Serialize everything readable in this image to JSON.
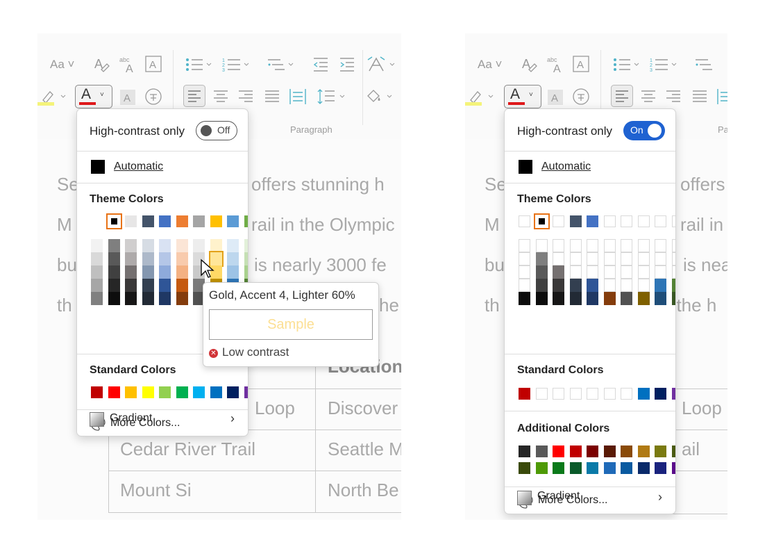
{
  "left": {
    "ribbon": {
      "font_aa": "Aa",
      "group_label": "Paragraph"
    },
    "doc_lines": [
      "Se",
      "M",
      "bu",
      "th"
    ],
    "doc_lines_right": [
      "offers stunning h",
      "rail in the Olympic",
      "is nearly 3000  fe",
      "he"
    ],
    "table": {
      "header_location": "Location",
      "rows": [
        {
          "name": "Loop",
          "location": "Discover"
        },
        {
          "name": "Cedar River Trail",
          "location": "Seattle M"
        },
        {
          "name": "Mount Si",
          "location": "North Be"
        }
      ]
    },
    "menu": {
      "high_contrast_label": "High-contrast only",
      "toggle_state": "Off",
      "automatic": "Automatic",
      "theme_colors": "Theme Colors",
      "theme_top": [
        "#ffffff",
        "#000000",
        "#e7e6e6",
        "#44546a",
        "#4472c4",
        "#ed7d31",
        "#a5a5a5",
        "#ffc000",
        "#5b9bd5",
        "#70ad47"
      ],
      "theme_shades": [
        [
          "#f2f2f2",
          "#d9d9d9",
          "#bfbfbf",
          "#a6a6a6",
          "#808080"
        ],
        [
          "#7f7f7f",
          "#595959",
          "#404040",
          "#262626",
          "#0d0d0d"
        ],
        [
          "#d0cece",
          "#aeaaaa",
          "#757070",
          "#3a3838",
          "#171616"
        ],
        [
          "#d6dce4",
          "#adb9ca",
          "#8497b0",
          "#333f50",
          "#222a35"
        ],
        [
          "#d9e2f3",
          "#b4c6e7",
          "#8eaadb",
          "#2f5597",
          "#1f3864"
        ],
        [
          "#fbe5d6",
          "#f8cbad",
          "#f4b183",
          "#c55a11",
          "#843c0c"
        ],
        [
          "#ededed",
          "#dbdbdb",
          "#c9c9c9",
          "#7b7b7b",
          "#525252"
        ],
        [
          "#fff2cc",
          "#ffe699",
          "#ffd966",
          "#bf9000",
          "#7f6000"
        ],
        [
          "#deebf7",
          "#bdd7ee",
          "#9dc3e6",
          "#2e75b6",
          "#1f4e79"
        ],
        [
          "#e2f0d9",
          "#c5e0b4",
          "#a9d18e",
          "#548235",
          "#385723"
        ]
      ],
      "standard_colors": "Standard Colors",
      "standard": [
        "#c00000",
        "#ff0000",
        "#ffc000",
        "#ffff00",
        "#92d050",
        "#00b050",
        "#00b0f0",
        "#0070c0",
        "#002060",
        "#7030a0"
      ],
      "more_colors": "More Colors...",
      "gradient": "Gradient"
    },
    "tooltip": {
      "title": "Gold, Accent 4, Lighter 60%",
      "sample": "Sample",
      "warning": "Low contrast"
    }
  },
  "right": {
    "ribbon": {
      "font_aa": "Aa",
      "group_label": "Pa"
    },
    "doc_lines": [
      "Se",
      "M",
      "bu",
      "th"
    ],
    "doc_lines_right": [
      "offers",
      "rail in",
      "is nea",
      "f the h"
    ],
    "table": {
      "rows": [
        {
          "name": "Loop"
        },
        {
          "name": "ail"
        }
      ]
    },
    "menu": {
      "high_contrast_label": "High-contrast only",
      "toggle_state": "On",
      "automatic": "Automatic",
      "theme_colors": "Theme Colors",
      "theme_top": [
        "",
        "#000000",
        "",
        "#44546a",
        "#4472c4",
        "",
        "",
        "",
        "",
        ""
      ],
      "theme_shades": [
        [
          "",
          "",
          "",
          "",
          "#0d0d0d"
        ],
        [
          "",
          "#7f7f7f",
          "#595959",
          "#404040",
          "#0d0d0d"
        ],
        [
          "",
          "",
          "#757070",
          "#3a3838",
          "#171616"
        ],
        [
          "",
          "",
          "",
          "#333f50",
          "#222a35"
        ],
        [
          "",
          "",
          "",
          "#2f5597",
          "#1f3864"
        ],
        [
          "",
          "",
          "",
          "",
          "#843c0c"
        ],
        [
          "",
          "",
          "",
          "",
          "#525252"
        ],
        [
          "",
          "",
          "",
          "",
          "#7f6000"
        ],
        [
          "",
          "",
          "",
          "#2e75b6",
          "#1f4e79"
        ],
        [
          "",
          "",
          "",
          "#548235",
          "#385723"
        ]
      ],
      "standard_colors": "Standard Colors",
      "standard": [
        "#c00000",
        "",
        "",
        "",
        "",
        "",
        "",
        "#0070c0",
        "#002060",
        "#7030a0"
      ],
      "additional_colors": "Additional Colors",
      "additional_row1": [
        "#262626",
        "#595959",
        "#ff0000",
        "#c00000",
        "#7b0000",
        "#5a1a05",
        "#8a4b08",
        "#b07a14",
        "#7a7a10",
        "#4a5a12"
      ],
      "additional_row2": [
        "#3a4a0a",
        "#4e9a06",
        "#0a7a1a",
        "#0a5a2a",
        "#0a7aa8",
        "#1f6ab8",
        "#0a5aa0",
        "#0a2a6a",
        "#1a237e",
        "#5a0a8a"
      ],
      "more_colors": "More Colors...",
      "gradient": "Gradient"
    }
  }
}
